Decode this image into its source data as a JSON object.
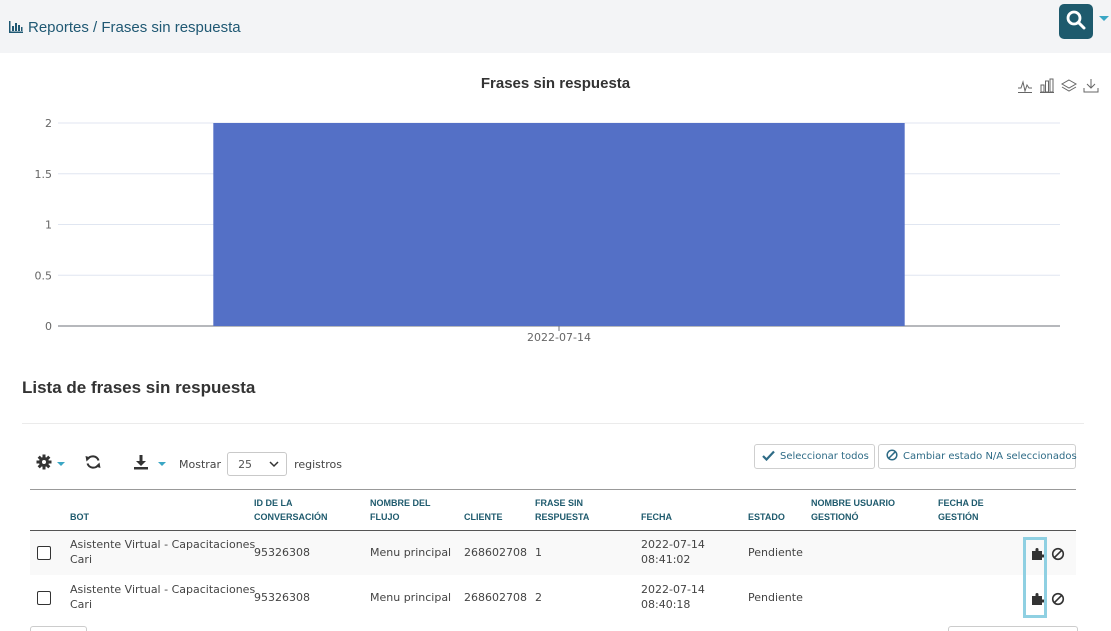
{
  "header": {
    "breadcrumb": "Reportes / Frases sin respuesta",
    "breadcrumb_icon": "bar-chart-icon",
    "search_icon": "search-icon"
  },
  "chart_data": {
    "type": "bar",
    "title": "Frases sin respuesta",
    "categories": [
      "2022-07-14"
    ],
    "values": [
      2
    ],
    "ylim": [
      0,
      2
    ],
    "yticks": [
      "0",
      "0.5",
      "1",
      "1.5",
      "2"
    ],
    "grid": true,
    "color": "#5470c6",
    "tools": [
      "line-chart-icon",
      "bar-chart-icon",
      "stack-icon",
      "download-icon"
    ]
  },
  "list": {
    "title": "Lista de frases sin respuesta",
    "show_label": "Mostrar",
    "page_size": "25",
    "records_label": "registros",
    "select_all_label": "Seleccionar todos",
    "change_state_label": "Cambiar estado N/A seleccionados"
  },
  "table": {
    "headers": {
      "bot": "BOT",
      "conversation_id_1": "ID DE LA",
      "conversation_id_2": "CONVERSACIÓN",
      "flow_1": "NOMBRE DEL",
      "flow_2": "FLUJO",
      "client": "CLIENTE",
      "phrase_1": "FRASE SIN",
      "phrase_2": "RESPUESTA",
      "date": "FECHA",
      "state": "ESTADO",
      "user_1": "NOMBRE USUARIO",
      "user_2": "GESTIONÓ",
      "mgmt_date_1": "FECHA DE",
      "mgmt_date_2": "GESTIÓN"
    },
    "rows": [
      {
        "bot_1": "Asistente Virtual - Capacitaciones",
        "bot_2": "Cari",
        "conversation_id": "95326308",
        "flow": "Menu principal",
        "client": "268602708",
        "phrase": "1",
        "date_1": "2022-07-14",
        "date_2": "08:41:02",
        "state": "Pendiente"
      },
      {
        "bot_1": "Asistente Virtual - Capacitaciones",
        "bot_2": "Cari",
        "conversation_id": "95326308",
        "flow": "Menu principal",
        "client": "268602708",
        "phrase": "2",
        "date_1": "2022-07-14",
        "date_2": "08:40:18",
        "state": "Pendiente"
      }
    ]
  }
}
